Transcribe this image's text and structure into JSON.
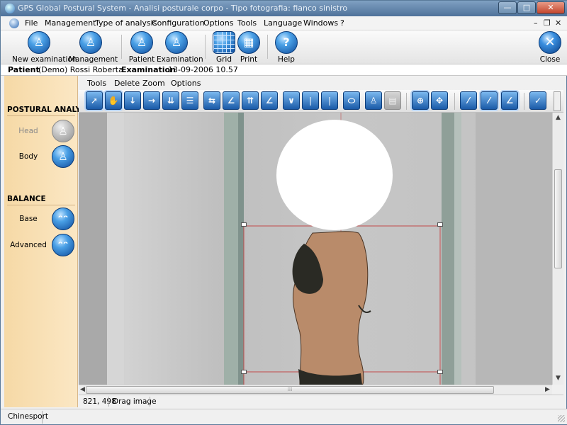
{
  "window": {
    "title": "GPS Global Postural System - Analisi posturale corpo - Tipo fotografia: fianco sinistro",
    "controls": {
      "minimize": "—",
      "maximize": "□",
      "close": "✕"
    }
  },
  "menubar": {
    "items": [
      "File",
      "Management",
      "Type of analysis",
      "Configuration",
      "Options",
      "Tools",
      "Language",
      "Windows",
      "?"
    ],
    "mdi_controls": {
      "minimize": "–",
      "restore": "❐",
      "close": "✕"
    }
  },
  "toolbar": {
    "buttons": [
      {
        "label": "New examination",
        "icon": "person-icon"
      },
      {
        "label": "Management",
        "icon": "person-icon"
      },
      {
        "label": "Patient",
        "icon": "person-icon"
      },
      {
        "label": "Examination",
        "icon": "person-icon"
      },
      {
        "label": "Grid",
        "icon": "grid-icon"
      },
      {
        "label": "Print",
        "icon": "print-icon"
      },
      {
        "label": "Help",
        "icon": "help-icon"
      },
      {
        "label": "Close",
        "icon": "close-icon"
      }
    ],
    "glyphs": {
      "person": "♙",
      "help": "?",
      "close": "✕",
      "print": "▦"
    }
  },
  "info": {
    "patient_label": "Patient",
    "patient_value": "(Demo) Rossi Roberta",
    "exam_label": "Examination",
    "exam_value": "13-09-2006 10.57"
  },
  "sidebar": {
    "postural_title": "POSTURAL ANALYSIS",
    "head": "Head",
    "body": "Body",
    "balance_title": "BALANCE",
    "base": "Base",
    "advanced": "Advanced",
    "glyph_person": "♙",
    "glyph_feet": "ᵔᵔ"
  },
  "canvas_menu": {
    "items": [
      "Tools",
      "Delete",
      "Zoom",
      "Options"
    ]
  },
  "canvas_tools": {
    "glyphs": [
      "➚",
      "✋",
      "↓",
      "→",
      "⇊",
      "☰",
      "⇆",
      "∠",
      "⇈",
      "∠",
      "∨",
      "❘",
      "❘",
      "⬭",
      "♙",
      "▤",
      "⊕",
      "✥",
      "⁄",
      "⁄",
      "∠",
      "✓"
    ]
  },
  "status": {
    "coords": "821, 498",
    "mode": "Drag image"
  },
  "footer": {
    "brand": "Chinesport"
  },
  "colors": {
    "accent": "#1a5aa8",
    "sidebar_bg": "#f6d9a6",
    "titlebar": "#4f729a",
    "grid_line": "#c24a4a"
  }
}
